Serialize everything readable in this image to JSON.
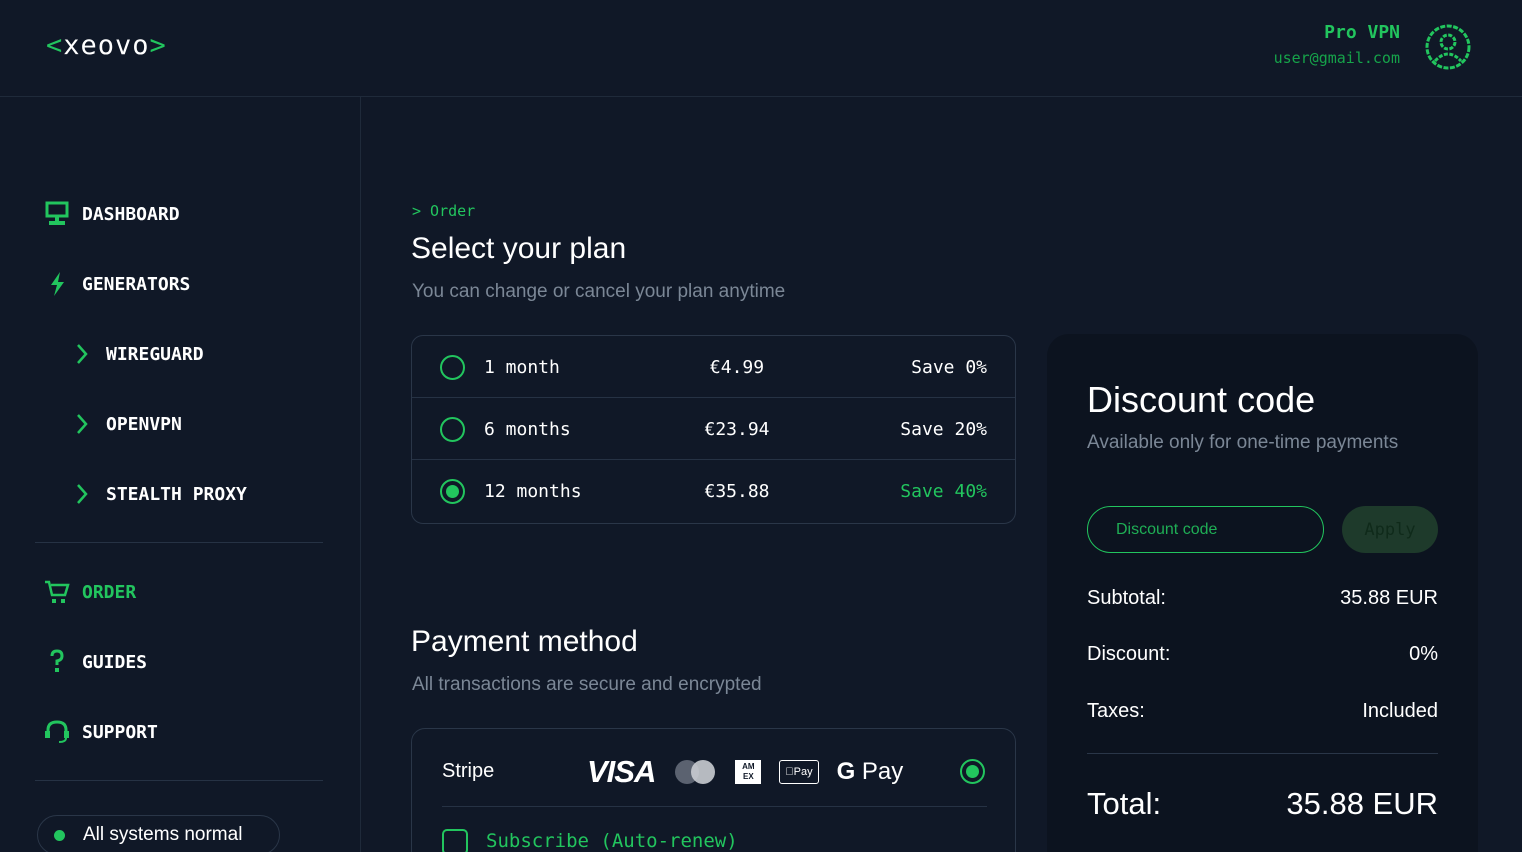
{
  "header": {
    "logo_left": "<",
    "logo_text": "xeovo",
    "logo_right": ">",
    "plan_name": "Pro VPN",
    "email": "user@gmail.com"
  },
  "sidebar": {
    "items": [
      {
        "label": "DASHBOARD",
        "icon": "monitor-icon"
      },
      {
        "label": "GENERATORS",
        "icon": "lightning-icon"
      },
      {
        "label": "WIREGUARD",
        "icon": "chevron-right-icon"
      },
      {
        "label": "OPENVPN",
        "icon": "chevron-right-icon"
      },
      {
        "label": "STEALTH PROXY",
        "icon": "chevron-right-icon"
      },
      {
        "label": "ORDER",
        "icon": "cart-icon",
        "active": true
      },
      {
        "label": "GUIDES",
        "icon": "question-icon"
      },
      {
        "label": "SUPPORT",
        "icon": "headset-icon"
      }
    ],
    "status": "All systems normal"
  },
  "main": {
    "breadcrumb": "> Order",
    "plan_title": "Select your plan",
    "plan_subtitle": "You can change or cancel your plan anytime",
    "plans": [
      {
        "duration": "1 month",
        "price": "€4.99",
        "save": "Save 0%",
        "selected": false
      },
      {
        "duration": "6 months",
        "price": "€23.94",
        "save": "Save 20%",
        "selected": false
      },
      {
        "duration": "12 months",
        "price": "€35.88",
        "save": "Save 40%",
        "selected": true
      }
    ],
    "payment_title": "Payment method",
    "payment_subtitle": "All transactions are secure and encrypted",
    "payment": {
      "provider": "Stripe",
      "visa": "VISA",
      "amex_top": "AM",
      "amex_bottom": "EX",
      "apple_pay": "Pay",
      "google_pay_g": "G",
      "google_pay": "Pay",
      "subscribe_label": "Subscribe (Auto-renew)"
    }
  },
  "discount": {
    "title": "Discount code",
    "subtitle": "Available only for one-time payments",
    "placeholder": "Discount code",
    "apply_label": "Apply",
    "subtotal_label": "Subtotal:",
    "subtotal_value": "35.88 EUR",
    "discount_label": "Discount:",
    "discount_value": "0%",
    "taxes_label": "Taxes:",
    "taxes_value": "Included",
    "total_label": "Total:",
    "total_value": "35.88 EUR"
  },
  "colors": {
    "background": "#101827",
    "accent": "#22c55e",
    "panel": "#0c131f",
    "muted_text": "#7b8796"
  }
}
